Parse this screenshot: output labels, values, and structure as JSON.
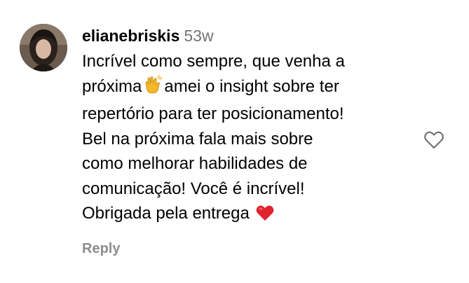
{
  "comment": {
    "username": "elianebriskis",
    "timestamp": "53w",
    "text_lines": [
      "Incrível como sempre, que venha a",
      "próxima",
      "amei o insight sobre ter",
      "repertório para ter posicionamento!",
      "Bel na próxima fala mais sobre",
      "como melhorar habilidades de",
      "comunicação! Você é incrível!",
      "Obrigada pela entrega"
    ],
    "reply_label": "Reply",
    "like_icon": "heart-outline-icon",
    "emojis": [
      "clapping-hands-icon",
      "red-heart-icon"
    ]
  },
  "colors": {
    "text": "#000000",
    "muted": "#737373",
    "reply": "#8e8e8e",
    "heart_emoji": "#e0242e",
    "clap_emoji": "#f5b72c"
  }
}
